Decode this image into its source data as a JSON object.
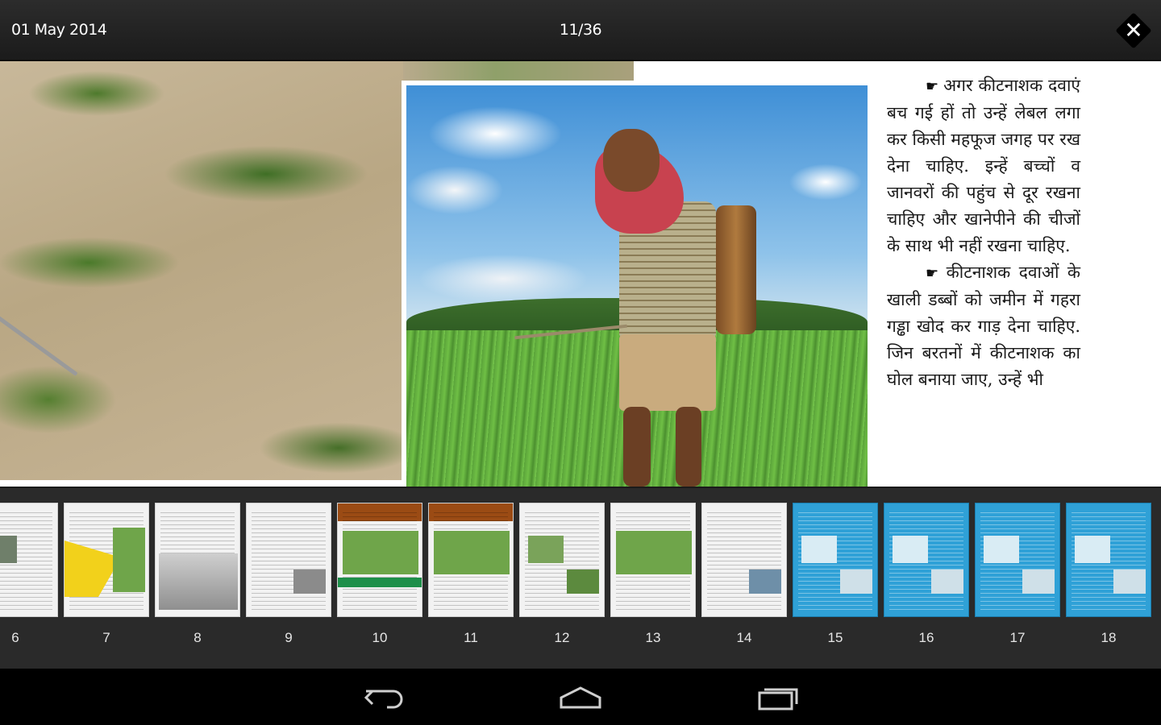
{
  "header": {
    "date": "01 May 2014",
    "page_indicator": "11/36",
    "close_icon": "close-icon"
  },
  "article": {
    "paragraph_1": "अगर कीटनाशक दवाएं बच गई हों तो उन्हें लेबल लगा कर किसी महफूज जगह पर रख देना चाहिए. इन्हें बच्चों व जानवरों की पहुंच से दूर रखना चाहिए और खानेपीने की चीजों के साथ भी नहीं रखना चाहिए.",
    "paragraph_2": "कीटनाशक दवाओं के खाली डब्बों को जमीन में गहरा गड्ढा खोद कर गाड़ देना चाहिए. जिन बरतनों में कीटनाशक का घोल बनाया जाए, उन्हें भी",
    "pointer_icon": "hand-pointer-icon"
  },
  "thumbnails": {
    "pages": [
      {
        "label": "6",
        "style": "white"
      },
      {
        "label": "7",
        "style": "white"
      },
      {
        "label": "8",
        "style": "white"
      },
      {
        "label": "9",
        "style": "white"
      },
      {
        "label": "10",
        "style": "white"
      },
      {
        "label": "11",
        "style": "white"
      },
      {
        "label": "12",
        "style": "white"
      },
      {
        "label": "13",
        "style": "white"
      },
      {
        "label": "14",
        "style": "white"
      },
      {
        "label": "15",
        "style": "blue"
      },
      {
        "label": "16",
        "style": "blue"
      },
      {
        "label": "17",
        "style": "blue"
      },
      {
        "label": "18",
        "style": "blue"
      }
    ],
    "current_page": "11"
  },
  "navbar": {
    "back_icon": "back-icon",
    "home_icon": "home-icon",
    "recent_apps_icon": "recent-apps-icon"
  },
  "colors": {
    "topbar": "#222222",
    "thumb_blue": "#2fa1d7",
    "navbar": "#000000"
  }
}
